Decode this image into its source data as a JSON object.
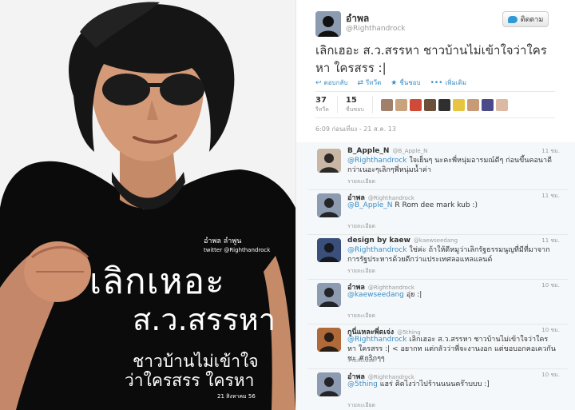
{
  "photo": {
    "shirt_name": "อำพล ลำพูน",
    "shirt_handle": "twitter @Righthandrock",
    "shirt_big1": "เลิกเหอะ",
    "shirt_big2": "ส.ว.สรรหา",
    "shirt_line1": "ชาวบ้านไม่เข้าใจ",
    "shirt_line2": "ว่าใครสรร ใครหา",
    "shirt_date": "21 สิงหาคม 56"
  },
  "tweet": {
    "name": "อำพล",
    "handle": "@Righthandrock",
    "follow_label": "ติดตาม",
    "text": "เลิกเฮอะ ส.ว.สรรหา ชาวบ้านไม่เข้าใจว่าใครหา ใครสรร :|",
    "actions": [
      {
        "icon": "reply-icon",
        "glyph": "↩",
        "label": "ตอบกลับ"
      },
      {
        "icon": "retweet-icon",
        "glyph": "⇄",
        "label": "รีทวีต"
      },
      {
        "icon": "star-icon",
        "glyph": "★",
        "label": "ชื่นชอบ"
      },
      {
        "icon": "more-icon",
        "glyph": "•••",
        "label": "เพิ่มเติม"
      }
    ],
    "retweets": "37",
    "retweets_label": "รีทวีต",
    "favorites": "15",
    "favorites_label": "ชื่นชอบ",
    "timestamp": "6:09 ก่อนเที่ยง - 21 ส.ค. 13",
    "face_colors": [
      "#a0806a",
      "#c9a27e",
      "#d04a3a",
      "#6b4f3a",
      "#2f2f2f",
      "#e8c541",
      "#c79a78",
      "#4a4a8a",
      "#dcb9a2"
    ]
  },
  "replies": [
    {
      "name": "B_Apple_N",
      "handle": "@B_Apple_N",
      "time": "11 ชม.",
      "mention": "@Righthandrock",
      "text": " ใจเย็นๆ นะคะพี่หนุ่มอารมณ์ดีๆ ก่อนขึ้นคอนาดีกว่าเนอะๆเลิกๆพี่หนุ่มน้ำค่า",
      "detail": "รายละเอียด",
      "avatar_color": "#c9b7a6"
    },
    {
      "name": "อำพล",
      "handle": "@Righthandrock",
      "time": "11 ชม.",
      "mention": "@B_Apple_N",
      "text": "  R Rom dee mark kub :)",
      "detail": "รายละเอียด",
      "avatar_color": "#8d9bb0"
    },
    {
      "name": "design by kaew",
      "handle": "@kaewseedang",
      "time": "11 ชม.",
      "mention": "@Righthandrock",
      "text": " ใช่ค่ะ ถ้าให้ดีหมูว่าเลิกรัฐธรรมนูญที่มีที่มาจากการรัฐประหารด้วยดีกว่าแประเทศลอแหลแลนด์",
      "detail": "รายละเอียด",
      "avatar_color": "#3a4f7a"
    },
    {
      "name": "อำพล",
      "handle": "@Righthandrock",
      "time": "10 ชม.",
      "mention": "@kaewseedang",
      "text": "  อุ่ย :|",
      "detail": "รายละเอียด",
      "avatar_color": "#8d9bb0"
    },
    {
      "name": "กูนี่แหละพี่ดเจ่ง",
      "handle": "@5thing",
      "time": "10 ชม.",
      "mention": "@Righthandrock",
      "text": " เลิกเฮอะ ส.ว.สรรหา ชาวบ้านไม่เข้าใจว่าใครหา ใครสรร :| < อยากท แต่กลัวว่าพี่จะงานงอก แต่ขอบอกคอเควกันชะ #กริกๆๆ",
      "detail": "รายละเอียด",
      "avatar_color": "#b06a3a"
    },
    {
      "name": "อำพล",
      "handle": "@Righthandrock",
      "time": "10 ชม.",
      "mention": "@5thing",
      "text": "  แฮร่ คิดไงว่าไปร้านนนนคร๊าบบบ :]",
      "detail": "รายละเอียด",
      "avatar_color": "#8d9bb0"
    }
  ]
}
